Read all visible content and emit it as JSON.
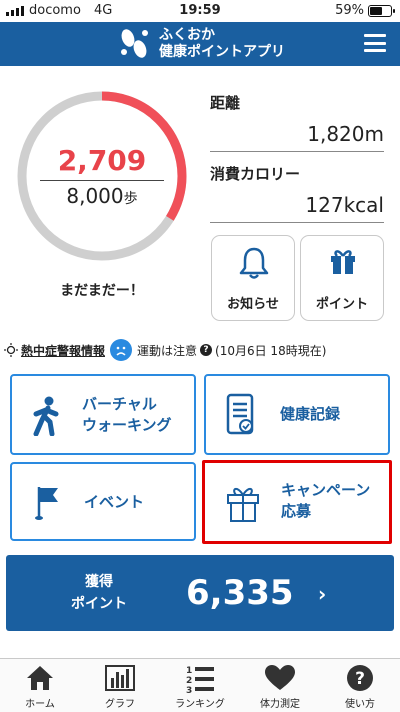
{
  "status": {
    "carrier": "docomo",
    "network": "4G",
    "time": "19:59",
    "battery": "59%",
    "battery_level": 0.59
  },
  "header": {
    "title_line1": "ふくおか",
    "title_line2": "健康ポイントアプリ"
  },
  "steps": {
    "current": "2,709",
    "goal": "8,000",
    "unit": "歩",
    "progress": 0.3386,
    "caption": "まだまだー！"
  },
  "distance": {
    "label": "距離",
    "value": "1,820m"
  },
  "calories": {
    "label": "消費カロリー",
    "value": "127kcal"
  },
  "tiles": {
    "notices": "お知らせ",
    "points": "ポイント"
  },
  "heat": {
    "link": "熱中症警報情報",
    "status": "運動は注意",
    "updated": "(10月6日 18時現在)"
  },
  "menu": {
    "virtual_walking_l1": "バーチャル",
    "virtual_walking_l2": "ウォーキング",
    "health_record": "健康記録",
    "event": "イベント",
    "campaign_l1": "キャンペーン",
    "campaign_l2": "応募"
  },
  "points": {
    "label_l1": "獲得",
    "label_l2": "ポイント",
    "value": "6,335",
    "chevron": "›"
  },
  "tabs": [
    {
      "label": "ホーム",
      "icon": "home-icon"
    },
    {
      "label": "グラフ",
      "icon": "bar-graph-icon"
    },
    {
      "label": "ランキング",
      "icon": "ranking-icon"
    },
    {
      "label": "体力測定",
      "icon": "heart-icon"
    },
    {
      "label": "使い方",
      "icon": "help-icon"
    }
  ],
  "colors": {
    "primary": "#1a5fa0",
    "accent": "#2a8ae0",
    "steps_red": "#e8434a",
    "ring_gray": "#cfcfcf",
    "highlight": "#e00000"
  }
}
